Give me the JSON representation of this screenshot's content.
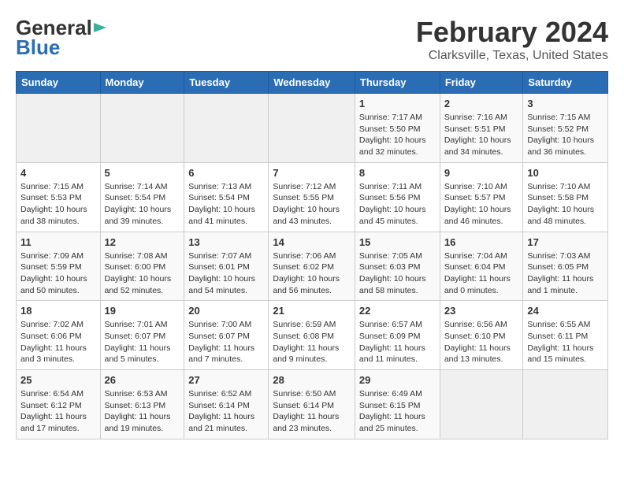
{
  "header": {
    "logo_general": "General",
    "logo_blue": "Blue",
    "title": "February 2024",
    "subtitle": "Clarksville, Texas, United States"
  },
  "weekdays": [
    "Sunday",
    "Monday",
    "Tuesday",
    "Wednesday",
    "Thursday",
    "Friday",
    "Saturday"
  ],
  "weeks": [
    [
      {
        "day": "",
        "info": ""
      },
      {
        "day": "",
        "info": ""
      },
      {
        "day": "",
        "info": ""
      },
      {
        "day": "",
        "info": ""
      },
      {
        "day": "1",
        "info": "Sunrise: 7:17 AM\nSunset: 5:50 PM\nDaylight: 10 hours\nand 32 minutes."
      },
      {
        "day": "2",
        "info": "Sunrise: 7:16 AM\nSunset: 5:51 PM\nDaylight: 10 hours\nand 34 minutes."
      },
      {
        "day": "3",
        "info": "Sunrise: 7:15 AM\nSunset: 5:52 PM\nDaylight: 10 hours\nand 36 minutes."
      }
    ],
    [
      {
        "day": "4",
        "info": "Sunrise: 7:15 AM\nSunset: 5:53 PM\nDaylight: 10 hours\nand 38 minutes."
      },
      {
        "day": "5",
        "info": "Sunrise: 7:14 AM\nSunset: 5:54 PM\nDaylight: 10 hours\nand 39 minutes."
      },
      {
        "day": "6",
        "info": "Sunrise: 7:13 AM\nSunset: 5:54 PM\nDaylight: 10 hours\nand 41 minutes."
      },
      {
        "day": "7",
        "info": "Sunrise: 7:12 AM\nSunset: 5:55 PM\nDaylight: 10 hours\nand 43 minutes."
      },
      {
        "day": "8",
        "info": "Sunrise: 7:11 AM\nSunset: 5:56 PM\nDaylight: 10 hours\nand 45 minutes."
      },
      {
        "day": "9",
        "info": "Sunrise: 7:10 AM\nSunset: 5:57 PM\nDaylight: 10 hours\nand 46 minutes."
      },
      {
        "day": "10",
        "info": "Sunrise: 7:10 AM\nSunset: 5:58 PM\nDaylight: 10 hours\nand 48 minutes."
      }
    ],
    [
      {
        "day": "11",
        "info": "Sunrise: 7:09 AM\nSunset: 5:59 PM\nDaylight: 10 hours\nand 50 minutes."
      },
      {
        "day": "12",
        "info": "Sunrise: 7:08 AM\nSunset: 6:00 PM\nDaylight: 10 hours\nand 52 minutes."
      },
      {
        "day": "13",
        "info": "Sunrise: 7:07 AM\nSunset: 6:01 PM\nDaylight: 10 hours\nand 54 minutes."
      },
      {
        "day": "14",
        "info": "Sunrise: 7:06 AM\nSunset: 6:02 PM\nDaylight: 10 hours\nand 56 minutes."
      },
      {
        "day": "15",
        "info": "Sunrise: 7:05 AM\nSunset: 6:03 PM\nDaylight: 10 hours\nand 58 minutes."
      },
      {
        "day": "16",
        "info": "Sunrise: 7:04 AM\nSunset: 6:04 PM\nDaylight: 11 hours\nand 0 minutes."
      },
      {
        "day": "17",
        "info": "Sunrise: 7:03 AM\nSunset: 6:05 PM\nDaylight: 11 hours\nand 1 minute."
      }
    ],
    [
      {
        "day": "18",
        "info": "Sunrise: 7:02 AM\nSunset: 6:06 PM\nDaylight: 11 hours\nand 3 minutes."
      },
      {
        "day": "19",
        "info": "Sunrise: 7:01 AM\nSunset: 6:07 PM\nDaylight: 11 hours\nand 5 minutes."
      },
      {
        "day": "20",
        "info": "Sunrise: 7:00 AM\nSunset: 6:07 PM\nDaylight: 11 hours\nand 7 minutes."
      },
      {
        "day": "21",
        "info": "Sunrise: 6:59 AM\nSunset: 6:08 PM\nDaylight: 11 hours\nand 9 minutes."
      },
      {
        "day": "22",
        "info": "Sunrise: 6:57 AM\nSunset: 6:09 PM\nDaylight: 11 hours\nand 11 minutes."
      },
      {
        "day": "23",
        "info": "Sunrise: 6:56 AM\nSunset: 6:10 PM\nDaylight: 11 hours\nand 13 minutes."
      },
      {
        "day": "24",
        "info": "Sunrise: 6:55 AM\nSunset: 6:11 PM\nDaylight: 11 hours\nand 15 minutes."
      }
    ],
    [
      {
        "day": "25",
        "info": "Sunrise: 6:54 AM\nSunset: 6:12 PM\nDaylight: 11 hours\nand 17 minutes."
      },
      {
        "day": "26",
        "info": "Sunrise: 6:53 AM\nSunset: 6:13 PM\nDaylight: 11 hours\nand 19 minutes."
      },
      {
        "day": "27",
        "info": "Sunrise: 6:52 AM\nSunset: 6:14 PM\nDaylight: 11 hours\nand 21 minutes."
      },
      {
        "day": "28",
        "info": "Sunrise: 6:50 AM\nSunset: 6:14 PM\nDaylight: 11 hours\nand 23 minutes."
      },
      {
        "day": "29",
        "info": "Sunrise: 6:49 AM\nSunset: 6:15 PM\nDaylight: 11 hours\nand 25 minutes."
      },
      {
        "day": "",
        "info": ""
      },
      {
        "day": "",
        "info": ""
      }
    ]
  ]
}
